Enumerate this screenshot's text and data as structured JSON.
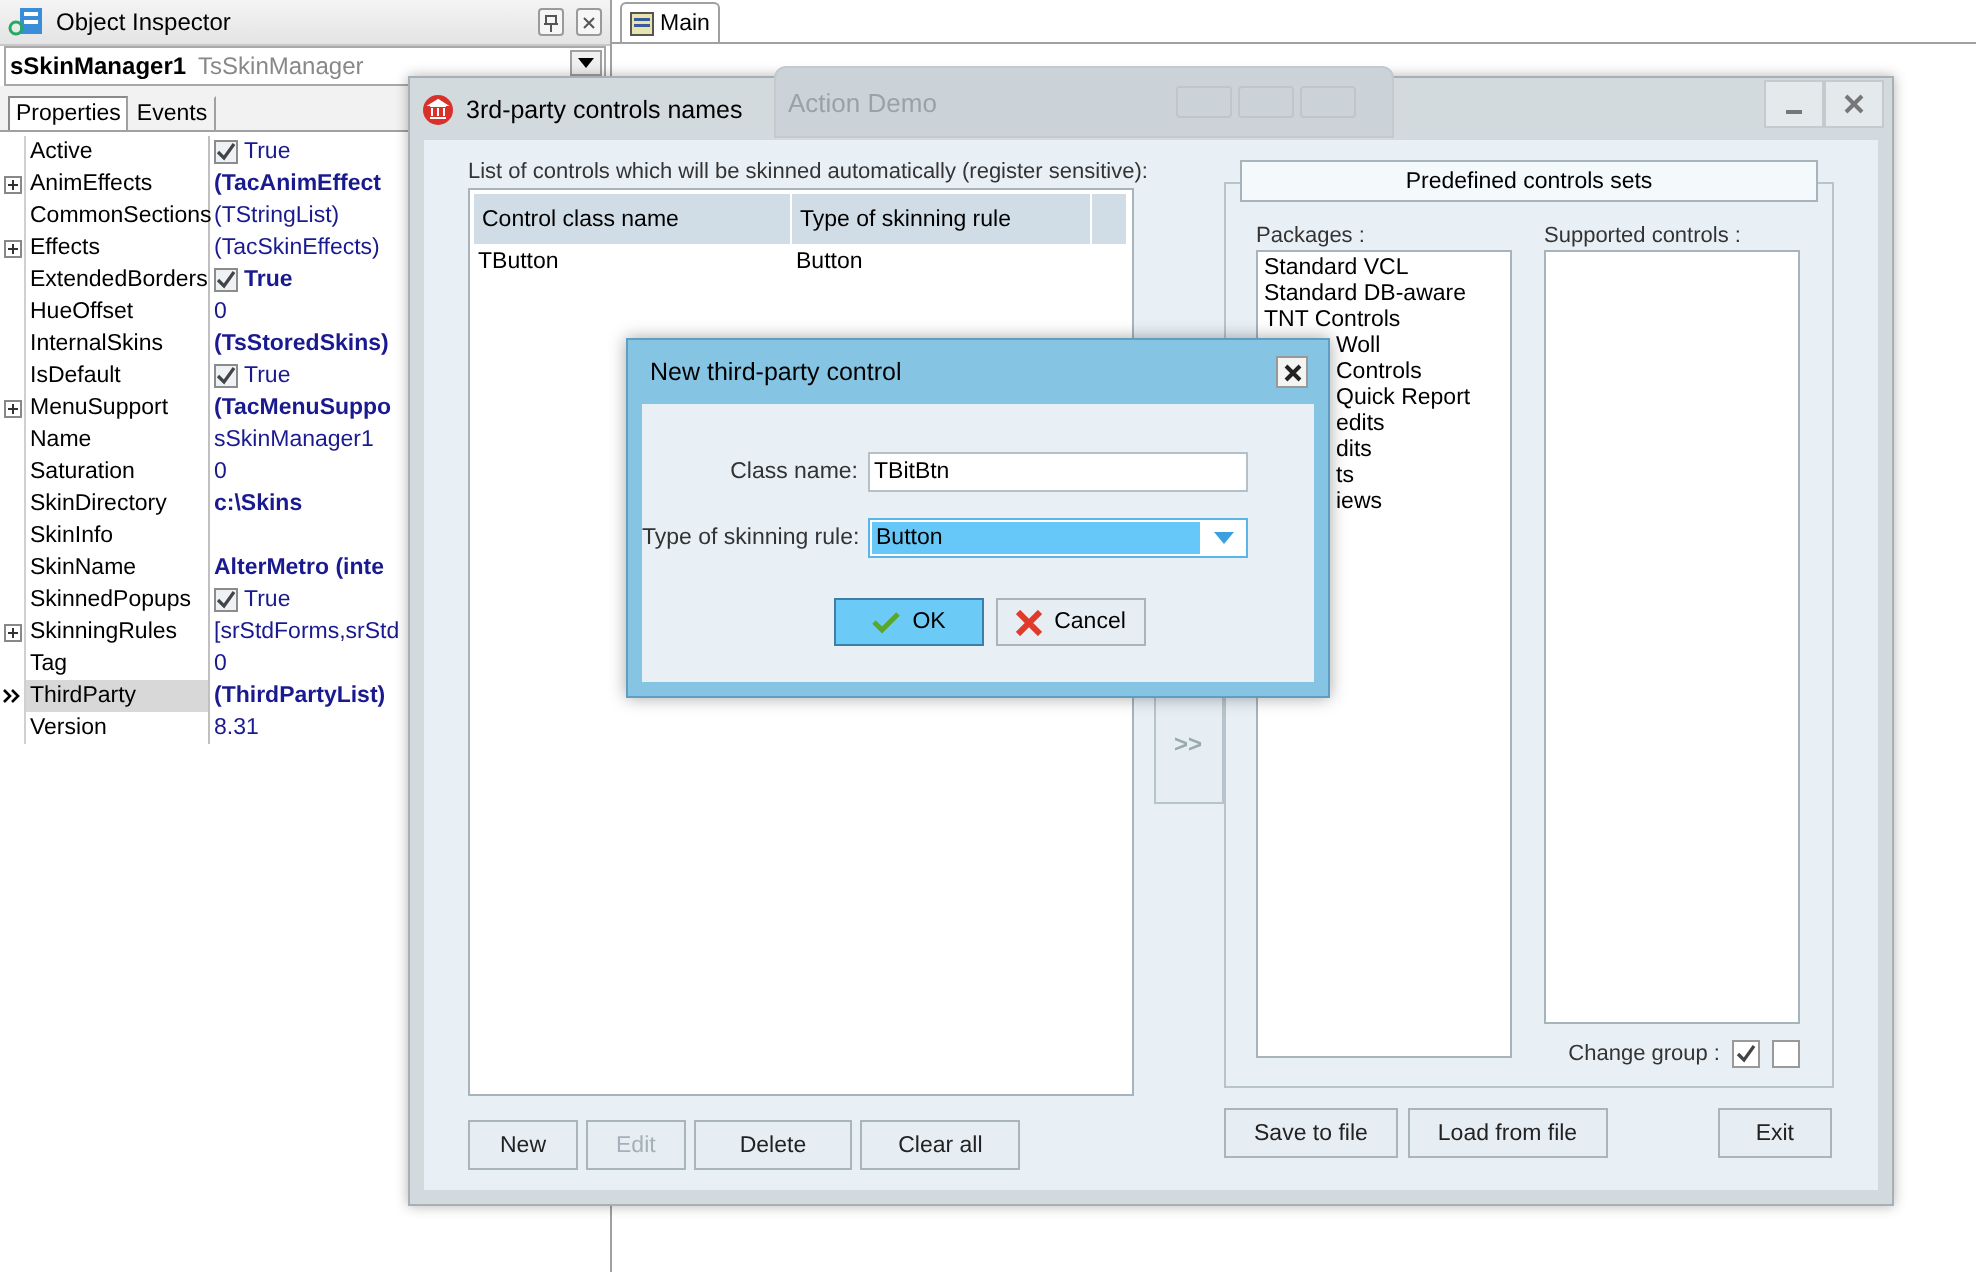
{
  "inspector": {
    "title": "Object Inspector",
    "object_name": "sSkinManager1",
    "object_type": "TsSkinManager",
    "tabs": [
      {
        "label": "Properties",
        "selected": true
      },
      {
        "label": "Events",
        "selected": false
      }
    ],
    "properties": [
      {
        "name": "Active",
        "value": "True",
        "kind": "check",
        "checked": true,
        "bold": false,
        "expandable": false,
        "selected": false
      },
      {
        "name": "AnimEffects",
        "value": "(TacAnimEffect",
        "kind": "text",
        "bold": true,
        "expandable": true,
        "selected": false
      },
      {
        "name": "CommonSections",
        "value": "(TStringList)",
        "kind": "text",
        "bold": false,
        "expandable": false,
        "selected": false
      },
      {
        "name": "Effects",
        "value": "(TacSkinEffects)",
        "kind": "text",
        "bold": false,
        "expandable": true,
        "selected": false
      },
      {
        "name": "ExtendedBorders",
        "value": "True",
        "kind": "check",
        "checked": true,
        "bold": true,
        "expandable": false,
        "selected": false
      },
      {
        "name": "HueOffset",
        "value": "0",
        "kind": "text",
        "bold": false,
        "expandable": false,
        "selected": false
      },
      {
        "name": "InternalSkins",
        "value": "(TsStoredSkins)",
        "kind": "text",
        "bold": true,
        "expandable": false,
        "selected": false
      },
      {
        "name": "IsDefault",
        "value": "True",
        "kind": "check",
        "checked": true,
        "bold": false,
        "expandable": false,
        "selected": false
      },
      {
        "name": "MenuSupport",
        "value": "(TacMenuSuppo",
        "kind": "text",
        "bold": true,
        "expandable": true,
        "selected": false
      },
      {
        "name": "Name",
        "value": "sSkinManager1",
        "kind": "text",
        "bold": false,
        "expandable": false,
        "selected": false
      },
      {
        "name": "Saturation",
        "value": "0",
        "kind": "text",
        "bold": false,
        "expandable": false,
        "selected": false
      },
      {
        "name": "SkinDirectory",
        "value": "c:\\Skins",
        "kind": "text",
        "bold": true,
        "expandable": false,
        "selected": false
      },
      {
        "name": "SkinInfo",
        "kind": "text",
        "expandable": false,
        "selected": false
      },
      {
        "name": "SkinName",
        "value": "AlterMetro (inte",
        "kind": "text",
        "bold": true,
        "expandable": false,
        "selected": false
      },
      {
        "name": "SkinnedPopups",
        "value": "True",
        "kind": "check",
        "checked": true,
        "bold": false,
        "expandable": false,
        "selected": false
      },
      {
        "name": "SkinningRules",
        "value": "[srStdForms,srStd",
        "kind": "text",
        "bold": false,
        "expandable": true,
        "selected": false
      },
      {
        "name": "Tag",
        "value": "0",
        "kind": "text",
        "bold": false,
        "expandable": false,
        "selected": false
      },
      {
        "name": "ThirdParty",
        "value": "(ThirdPartyList)",
        "kind": "text",
        "bold": true,
        "expandable": false,
        "selected": true
      },
      {
        "name": "Version",
        "value": "8.31",
        "kind": "text",
        "bold": false,
        "expandable": false,
        "selected": false
      }
    ]
  },
  "document_tab": {
    "label": "Main",
    "selected": true
  },
  "background_window": {
    "title": "Action Demo"
  },
  "controls_window": {
    "title": "3rd-party controls names",
    "list_label": "List of controls which will be skinned automatically (register sensitive):",
    "table": {
      "columns": [
        "Control class name",
        "Type of skinning rule"
      ],
      "rows": [
        [
          "TButton",
          "Button"
        ]
      ]
    },
    "transfer_button": ">>",
    "group_title": "Predefined controls sets",
    "packages_label": "Packages :",
    "packages": [
      {
        "label": "Standard VCL",
        "kind": "full"
      },
      {
        "label": "Standard DB-aware",
        "kind": "full"
      },
      {
        "label": "TNT Controls",
        "kind": "full"
      },
      {
        "label": "Woll",
        "kind": "partial"
      },
      {
        "label": "Controls",
        "kind": "partial"
      },
      {
        "label": "Quick Report",
        "kind": "partial"
      },
      {
        "label": "edits",
        "kind": "partial"
      },
      {
        "label": "dits",
        "kind": "partial"
      },
      {
        "label": "ts",
        "kind": "partial"
      },
      {
        "label": "iews",
        "kind": "partial"
      }
    ],
    "supported_label": "Supported controls :",
    "change_group": {
      "label": "Change group :",
      "checks": [
        {
          "checked": true
        },
        {
          "checked": false
        }
      ]
    },
    "left_buttons": [
      {
        "label": "New",
        "disabled": false
      },
      {
        "label": "Edit",
        "disabled": true
      },
      {
        "label": "Delete",
        "disabled": false
      },
      {
        "label": "Clear all",
        "disabled": false
      }
    ],
    "file_buttons": [
      {
        "label": "Save to file",
        "disabled": false
      },
      {
        "label": "Load from file",
        "disabled": false
      }
    ],
    "exit_button": "Exit"
  },
  "dialog": {
    "title": "New third-party control",
    "class_label": "Class name:",
    "class_value": "TBitBtn",
    "rule_label": "Type of skinning rule:",
    "rule_value": "Button",
    "buttons": [
      {
        "label": "OK",
        "kind": "ok",
        "default": true
      },
      {
        "label": "Cancel",
        "kind": "cancel",
        "default": false
      }
    ]
  }
}
